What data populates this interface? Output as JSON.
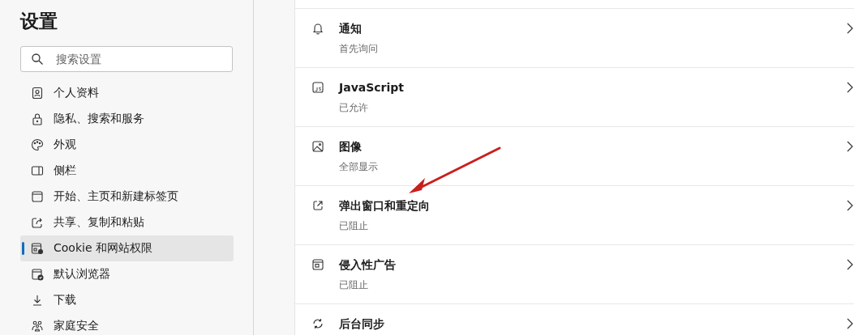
{
  "sidebar": {
    "title": "设置",
    "search": {
      "placeholder": "搜索设置"
    },
    "items": [
      {
        "label": "个人资料",
        "selected": false
      },
      {
        "label": "隐私、搜索和服务",
        "selected": false
      },
      {
        "label": "外观",
        "selected": false
      },
      {
        "label": "侧栏",
        "selected": false
      },
      {
        "label": "开始、主页和新建标签页",
        "selected": false
      },
      {
        "label": "共享、复制和粘贴",
        "selected": false
      },
      {
        "label": "Cookie 和网站权限",
        "selected": true
      },
      {
        "label": "默认浏览器",
        "selected": false
      },
      {
        "label": "下载",
        "selected": false
      },
      {
        "label": "家庭安全",
        "selected": false
      }
    ]
  },
  "permissions": [
    {
      "title": "通知",
      "status": "首先询问"
    },
    {
      "title": "JavaScript",
      "status": "已允许"
    },
    {
      "title": "图像",
      "status": "全部显示"
    },
    {
      "title": "弹出窗口和重定向",
      "status": "已阻止"
    },
    {
      "title": "侵入性广告",
      "status": "已阻止"
    },
    {
      "title": "后台同步"
    }
  ]
}
